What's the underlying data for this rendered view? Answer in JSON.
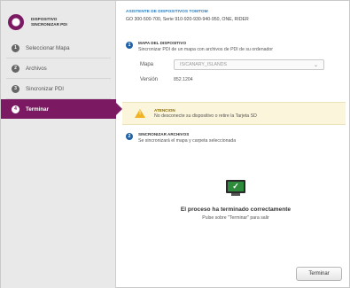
{
  "brand": {
    "line1": "DISPOSITIVO",
    "line2": "SINCRONIZAR PDI"
  },
  "nav": {
    "items": [
      {
        "num": "1",
        "label": "Seleccionar Mapa"
      },
      {
        "num": "2",
        "label": "Archivos"
      },
      {
        "num": "3",
        "label": "Sincronizar PDI"
      },
      {
        "num": "4",
        "label": "Terminar"
      }
    ]
  },
  "header": {
    "title": "ASISTENTE DE DISPOSITIVOS TOMTOM",
    "subtitle": "GO 300-500-700, Serie 910-920-930-940-950, ONE, RIDER"
  },
  "section1": {
    "num": "1",
    "title": "MAPA DEL DISPOSITIVO",
    "desc": "Sincronizar PDI de un mapa con archivos de PDI de su ordenador",
    "map_label": "Mapa",
    "map_value": "IS/CANARY_ISLANDS",
    "version_label": "Versión",
    "version_value": "852.1204"
  },
  "warning": {
    "title": "ATENCION",
    "text": "No desconecte su dispositivo o retire la Tarjeta SD"
  },
  "section2": {
    "num": "2",
    "title": "SINCRONIZAR ARCHIVOS",
    "desc": "Se sincronizará el mapa y carpeta seleccionada"
  },
  "done": {
    "title": "El proceso ha terminado correctamente",
    "subtitle": "Pulse sobre \"Terminar\" para salir"
  },
  "buttons": {
    "finish": "Terminar"
  },
  "colors": {
    "accent": "#7b1a63",
    "header_blue": "#2a7ec1",
    "success": "#2f8b3c",
    "warning_bg": "#fbf5db"
  }
}
